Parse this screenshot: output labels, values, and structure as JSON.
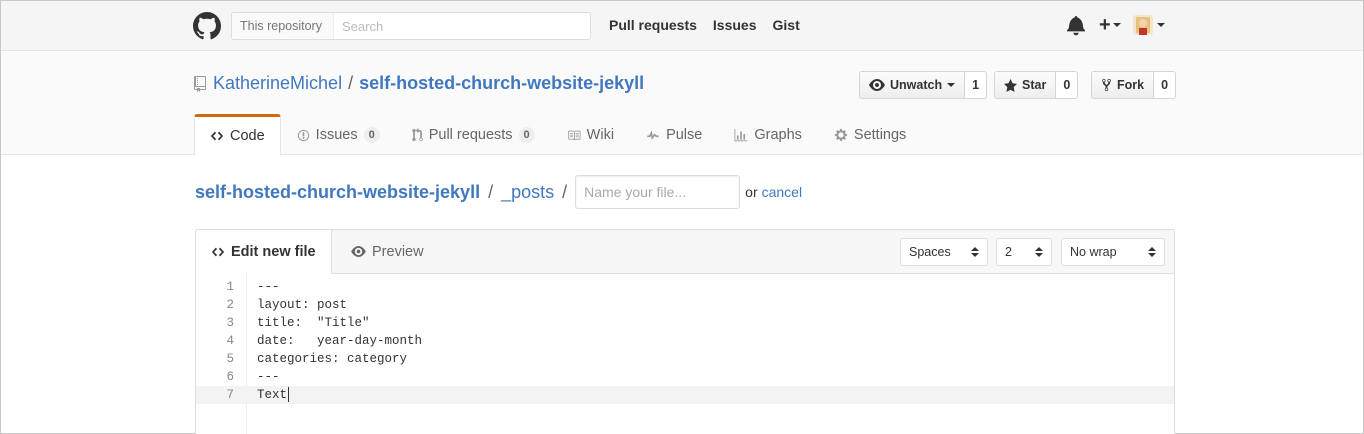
{
  "header": {
    "scope_label": "This repository",
    "search_placeholder": "Search",
    "nav": [
      "Pull requests",
      "Issues",
      "Gist"
    ]
  },
  "repo": {
    "owner": "KatherineMichel",
    "separator": "/",
    "name": "self-hosted-church-website-jekyll",
    "actions": {
      "watch_label": "Unwatch",
      "watch_count": "1",
      "star_label": "Star",
      "star_count": "0",
      "fork_label": "Fork",
      "fork_count": "0"
    },
    "tabs": [
      {
        "label": "Code",
        "icon": "code-icon"
      },
      {
        "label": "Issues",
        "count": "0",
        "icon": "issue-icon"
      },
      {
        "label": "Pull requests",
        "count": "0",
        "icon": "pull-request-icon"
      },
      {
        "label": "Wiki",
        "icon": "book-icon"
      },
      {
        "label": "Pulse",
        "icon": "pulse-icon"
      },
      {
        "label": "Graphs",
        "icon": "graph-icon"
      },
      {
        "label": "Settings",
        "icon": "gear-icon"
      }
    ]
  },
  "breadcrumb": {
    "root": "self-hosted-church-website-jekyll",
    "folder": "_posts",
    "separator": "/",
    "filename_placeholder": "Name your file...",
    "or_text": "or",
    "cancel_label": "cancel"
  },
  "editor": {
    "tabs": {
      "edit": "Edit new file",
      "preview": "Preview"
    },
    "indent_mode": "Spaces",
    "indent_size": "2",
    "wrap_mode": "No wrap",
    "lines": [
      {
        "num": "1",
        "text": "---"
      },
      {
        "num": "2",
        "text": "layout: post"
      },
      {
        "num": "3",
        "text": "title:  \"Title\""
      },
      {
        "num": "4",
        "text": "date:   year-day-month"
      },
      {
        "num": "5",
        "text": "categories: category"
      },
      {
        "num": "6",
        "text": "---"
      },
      {
        "num": "7",
        "text": "Text"
      }
    ],
    "active_line": 7
  },
  "colors": {
    "link": "#4078c0",
    "selected_tab_accent": "#d26911"
  }
}
